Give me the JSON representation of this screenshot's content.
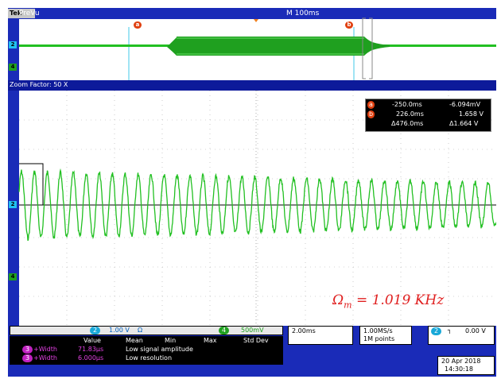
{
  "topbar": {
    "brand": "Tek",
    "mode": "PreVu",
    "timebase": "M 100ms"
  },
  "zoom": {
    "label": "Zoom Factor: 50 X"
  },
  "cursor_markers": {
    "a": "a",
    "b": "b"
  },
  "cursor_readout": {
    "a_time": "-250.0ms",
    "a_val": "-6.094mV",
    "b_time": "226.0ms",
    "b_val": "1.658 V",
    "d_time": "Δ476.0ms",
    "d_val": "Δ1.664 V"
  },
  "channels": {
    "ch2": "2",
    "ch4": "4",
    "ch3": "3"
  },
  "status": {
    "ch2_label": "2",
    "ch2_scale": "1.00 V",
    "ch2_unit": "Ω",
    "ch4_label": "4",
    "ch4_scale": "500mV",
    "horiz": "2.00ms",
    "rate": "1.00MS/s",
    "points": "1M points",
    "trig_ch": "2",
    "trig_level": "0.00 V",
    "date": "20 Apr 2018",
    "time": "14:30:18"
  },
  "measure": {
    "headers": [
      "Value",
      "Mean",
      "Min",
      "Max",
      "Std Dev"
    ],
    "rows": [
      {
        "ch": "3",
        "name": "+Width",
        "value": "71.83µs",
        "note": "Low signal amplitude"
      },
      {
        "ch": "3",
        "name": "+Width",
        "value": "6.000µs",
        "note": "Low resolution"
      }
    ]
  },
  "annotation": {
    "omega": "Ω",
    "sub": "m",
    "eq": " = 1.019 KHz"
  },
  "colors": {
    "trace": "#22c022",
    "bg": "#ffffff",
    "frame": "#1a2bb8",
    "cursor": "#40c8e8",
    "marker": "#e04010"
  }
}
